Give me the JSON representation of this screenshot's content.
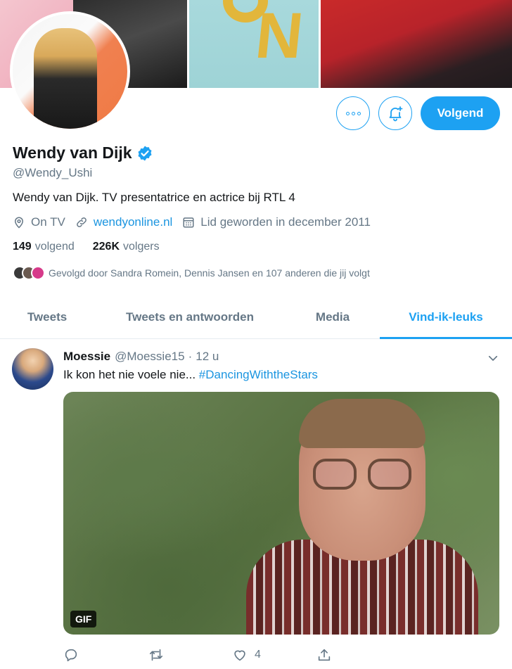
{
  "profile": {
    "name": "Wendy van Dijk",
    "handle": "@Wendy_Ushi",
    "bio": "Wendy van Dijk. TV presentatrice en actrice bij RTL 4",
    "location": "On TV",
    "website": "wendyonline.nl",
    "joined": "Lid geworden in december 2011",
    "following_count": "149",
    "following_label": "volgend",
    "followers_count": "226K",
    "followers_label": "volgers",
    "followed_by": "Gevolgd door Sandra Romein, Dennis Jansen en 107 anderen die jij volgt",
    "verified_icon": "verified-badge-icon"
  },
  "actions": {
    "follow_label": "Volgend",
    "more_icon": "more-icon",
    "notify_icon": "bell-plus-icon"
  },
  "tabs": [
    {
      "label": "Tweets"
    },
    {
      "label": "Tweets en antwoorden"
    },
    {
      "label": "Media"
    },
    {
      "label": "Vind-ik-leuks"
    }
  ],
  "active_tab": "Vind-ik-leuks",
  "tweet": {
    "author_name": "Moessie",
    "author_handle": "@Moessie15",
    "separator": "·",
    "time": "12 u",
    "text": "Ik kon het nie voele nie... ",
    "hashtag": "#DancingWiththeStars",
    "media_badge": "GIF",
    "like_count": "4"
  },
  "colors": {
    "accent": "#1da1f2",
    "link": "#1b95e0",
    "muted": "#657786",
    "text": "#14171a"
  }
}
